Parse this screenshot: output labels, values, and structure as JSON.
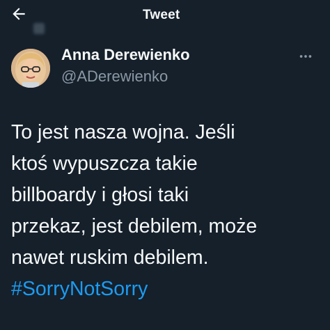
{
  "header": {
    "title": "Tweet",
    "back_icon": "arrow-left-icon"
  },
  "author": {
    "display_name": "Anna Derewienko",
    "handle": "@ADerewienko",
    "avatar_icon": "avatar-photo"
  },
  "tweet": {
    "lines": [
      "To jest nasza wojna. Jeśli",
      "ktoś wypuszcza takie",
      "billboardy i głosi taki",
      "przekaz, jest debilem, może",
      "nawet ruskim debilem."
    ],
    "hashtag": "#SorryNotSorry"
  },
  "colors": {
    "background": "#15202b",
    "text": "#f7f9f9",
    "secondary_text": "#8b98a5",
    "link": "#1d9bf0"
  }
}
